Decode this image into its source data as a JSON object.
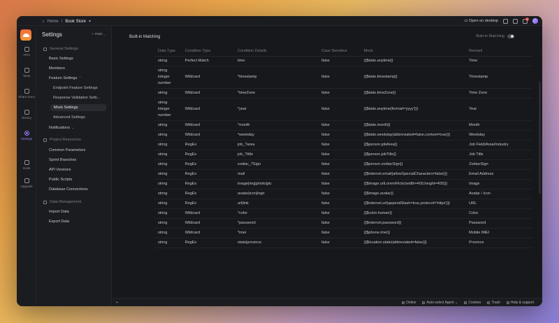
{
  "breadcrumb": {
    "home": "Home",
    "separator": "/",
    "project": "Book Store",
    "chevron": "▾"
  },
  "topbar": {
    "open_desktop": "Open on desktop",
    "notification_count": "1"
  },
  "rail": [
    {
      "label": "APIs",
      "icon": "api-icon"
    },
    {
      "label": "Tests",
      "icon": "tests-icon"
    },
    {
      "label": "Share Docs",
      "icon": "share-docs-icon"
    },
    {
      "label": "History",
      "icon": "history-icon"
    },
    {
      "label": "Settings",
      "icon": "settings-icon",
      "active": true
    },
    {
      "label": "Invite",
      "icon": "invite-icon"
    },
    {
      "label": "Upgrade",
      "icon": "upgrade-icon"
    }
  ],
  "sidebar": {
    "title": "Settings",
    "branch": "main",
    "general_section": "General Settings",
    "basic": "Basic Settings",
    "members": "Members",
    "feature": "Feature Settings",
    "endpoint": "Endpoint Feature Settings",
    "response": "Response Validation Setti...",
    "mock": "Mock Settings",
    "advanced": "Advanced Settings",
    "notifications": "Notifications",
    "resources_section": "Project Resources",
    "common": "Common Parameters",
    "sprint": "Sprint Branches",
    "api_versions": "API Versions",
    "public_scripts": "Public Scripts",
    "db": "Database Connections",
    "data_section": "Data Management",
    "import": "Import Data",
    "export": "Export Data"
  },
  "main": {
    "title": "Built-in Matching",
    "toggle_label": "Built-in Matching",
    "columns": [
      "Data Type",
      "Condition Type",
      "Condition Details",
      "Case Sensitive",
      "Mock",
      "Remark"
    ],
    "rows": [
      [
        "string",
        "Perfect Match",
        "time",
        "false",
        "{{$date.anytime}}",
        "Time"
      ],
      [
        "string integer number",
        "Wildcard",
        "*timestamp",
        "false",
        "{{$date.timestamp}}",
        "Timestamp"
      ],
      [
        "string",
        "Wildcard",
        "*timeZone",
        "false",
        "{{$date.timeZone}}",
        "Time Zone"
      ],
      [
        "string integer number",
        "Wildcard",
        "*year",
        "false",
        "{{$date.anytime(format='yyyy')}}",
        "Year"
      ],
      [
        "string",
        "Wildcard",
        "*month",
        "false",
        "{{$date.month}}",
        "Month"
      ],
      [
        "string",
        "Wildcard",
        "*weekday",
        "false",
        "{{$date.weekday(abbreviated=false,context=true)}}",
        "Weekday"
      ],
      [
        "string",
        "RegEx",
        "job_?area",
        "false",
        "{{$person.jobArea}}",
        "Job Field/Area/Industry"
      ],
      [
        "string",
        "RegEx",
        "job_?title",
        "false",
        "{{$person.jobTitle}}",
        "Job Title"
      ],
      [
        "string",
        "RegEx",
        "zodiac_?Sign",
        "false",
        "{{$person.zodiacSign}}",
        "ZodiacSign"
      ],
      [
        "string",
        "RegEx",
        "mail",
        "false",
        "{{$internet.email(allowSpecialCharacters=false)}}",
        "Email Address"
      ],
      [
        "string",
        "RegEx",
        "image|img|photo|pic",
        "false",
        "{{$image.urlLoremFlickr(width=400,height=400)}}",
        "Image"
      ],
      [
        "string",
        "RegEx",
        "avatar|icon|logo",
        "false",
        "{{$image.avatar}}",
        "Avatar / Icon"
      ],
      [
        "string",
        "RegEx",
        "url|link",
        "false",
        "{{$internet.url(appendSlash=true,protocol='https')}}",
        "URL"
      ],
      [
        "string",
        "Wildcard",
        "*color",
        "false",
        "{{$color.human}}",
        "Color"
      ],
      [
        "string",
        "Wildcard",
        "*password",
        "false",
        "{{$internet.password}}",
        "Password"
      ],
      [
        "string",
        "Wildcard",
        "*imei",
        "false",
        "{{$phone.imei}}",
        "Mobile IMEI"
      ],
      [
        "string",
        "RegEx",
        "state|province",
        "false",
        "{{$location.state(abbreviated=false)}}",
        "Province"
      ]
    ]
  },
  "statusbar": {
    "online": "Online",
    "agent": "Auto-select Agent",
    "cookies": "Cookies",
    "trash": "Trash",
    "help": "Help & support"
  }
}
